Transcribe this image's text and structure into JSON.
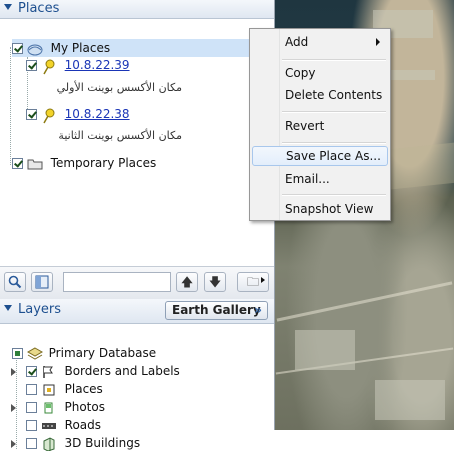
{
  "places": {
    "header": "Places",
    "items": [
      {
        "label": "My Places"
      },
      {
        "label": "10.8.22.39",
        "description": "مكان الأكسس بوينت الأولي"
      },
      {
        "label": "10.8.22.38",
        "description": "مكان الأكسس بوينت الثانية"
      },
      {
        "label": "Temporary Places"
      }
    ]
  },
  "toolbar": {
    "search_value": "",
    "up_glyph": "🡅",
    "down_glyph": "🡇",
    "folder_glyph": "🗀"
  },
  "layers": {
    "header": "Layers",
    "gallery_label": "Earth Gallery",
    "gallery_arrow": "»",
    "items": [
      {
        "label": "Primary Database"
      },
      {
        "label": "Borders and Labels"
      },
      {
        "label": "Places"
      },
      {
        "label": "Photos"
      },
      {
        "label": "Roads"
      },
      {
        "label": "3D Buildings"
      }
    ]
  },
  "context_menu": {
    "items": [
      "Add",
      "Copy",
      "Delete Contents",
      "Revert",
      "Save Place As...",
      "Email...",
      "Snapshot View"
    ],
    "highlighted": "Save Place As..."
  },
  "colors": {
    "header_text": "#1d4f8f",
    "link": "#1a35b6",
    "menu_highlight": "#e3eefb"
  }
}
